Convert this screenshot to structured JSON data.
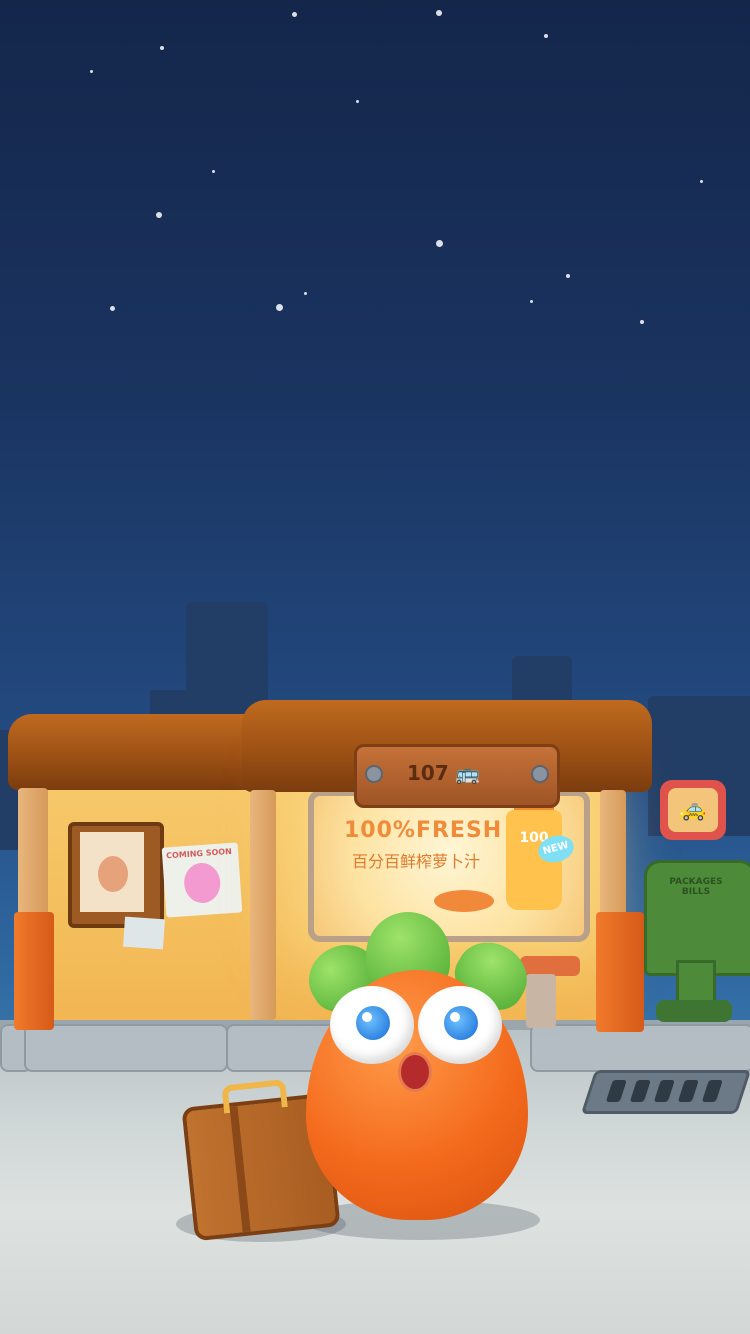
{
  "scene": {
    "type": "game-loading-scene",
    "bus_stop": {
      "route_sign": {
        "number": "107",
        "icon": "bus-icon"
      },
      "billboard": {
        "headline": "100%FRESH",
        "subline": "百分百鲜榨萝卜汁",
        "bottle_label": "100",
        "badge": "NEW"
      },
      "posters": {
        "coming_soon": "COMING SOON"
      },
      "taxi_sign_icon": "taxi-icon",
      "mailbox_label": "PACKAGES BILLS"
    },
    "colors": {
      "sky_top": "#14264a",
      "sky_bottom": "#3a78ad",
      "roof": "#9a4f14",
      "wall": "#f2b653",
      "carrot": "#f46a1c",
      "leaf": "#4aa72f",
      "mailbox": "#4d8a3a"
    }
  }
}
